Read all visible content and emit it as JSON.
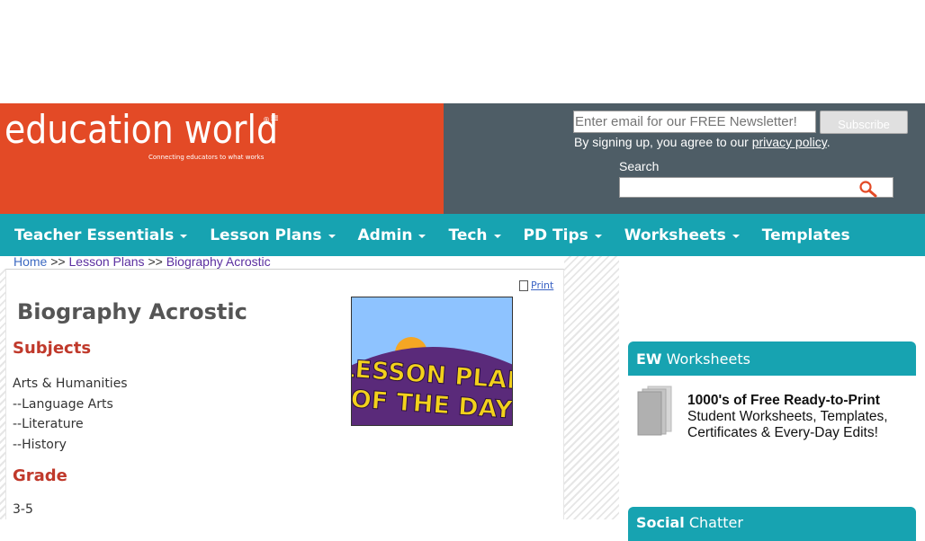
{
  "header": {
    "logo_main": "education world",
    "logo_reg": "®",
    "logo_tagline": "Connecting educators to what works",
    "newsletter_placeholder": "Enter email for our FREE Newsletter!",
    "subscribe_label": "Subscribe",
    "signup_prefix": "By signing up, you agree to our ",
    "privacy_link": "privacy policy",
    "signup_suffix": ".",
    "search_label": "Search"
  },
  "nav": {
    "items": [
      {
        "label": "Teacher Essentials",
        "dropdown": true
      },
      {
        "label": "Lesson Plans",
        "dropdown": true
      },
      {
        "label": "Admin",
        "dropdown": true
      },
      {
        "label": "Tech",
        "dropdown": true
      },
      {
        "label": "PD Tips",
        "dropdown": true
      },
      {
        "label": "Worksheets",
        "dropdown": true
      },
      {
        "label": "Templates",
        "dropdown": false
      }
    ]
  },
  "breadcrumb": {
    "home": "Home",
    "sep": ">>",
    "lesson_plans": "Lesson Plans",
    "current": "Biography Acrostic"
  },
  "article": {
    "print_label": "Print",
    "title": "Biography Acrostic",
    "subjects_heading": "Subjects",
    "subjects": [
      "Arts & Humanities",
      "--Language Arts",
      "--Literature",
      "--History"
    ],
    "grade_heading": "Grade",
    "grade": "3-5",
    "badge_line1": "LESSON PLAN",
    "badge_line2": "OF THE DAY"
  },
  "sidebar": {
    "ew_bold": "EW",
    "ew_rest": " Worksheets",
    "ew_line1": "1000's of Free Ready-to-Print",
    "ew_line2": "Student Worksheets, Templates, Certificates & Every-Day Edits!",
    "social_bold": "Social",
    "social_rest": " Chatter"
  },
  "colors": {
    "brand_orange": "#e34a26",
    "header_slate": "#4e5d66",
    "nav_teal": "#17a3b1",
    "heading_red": "#c0392b"
  }
}
